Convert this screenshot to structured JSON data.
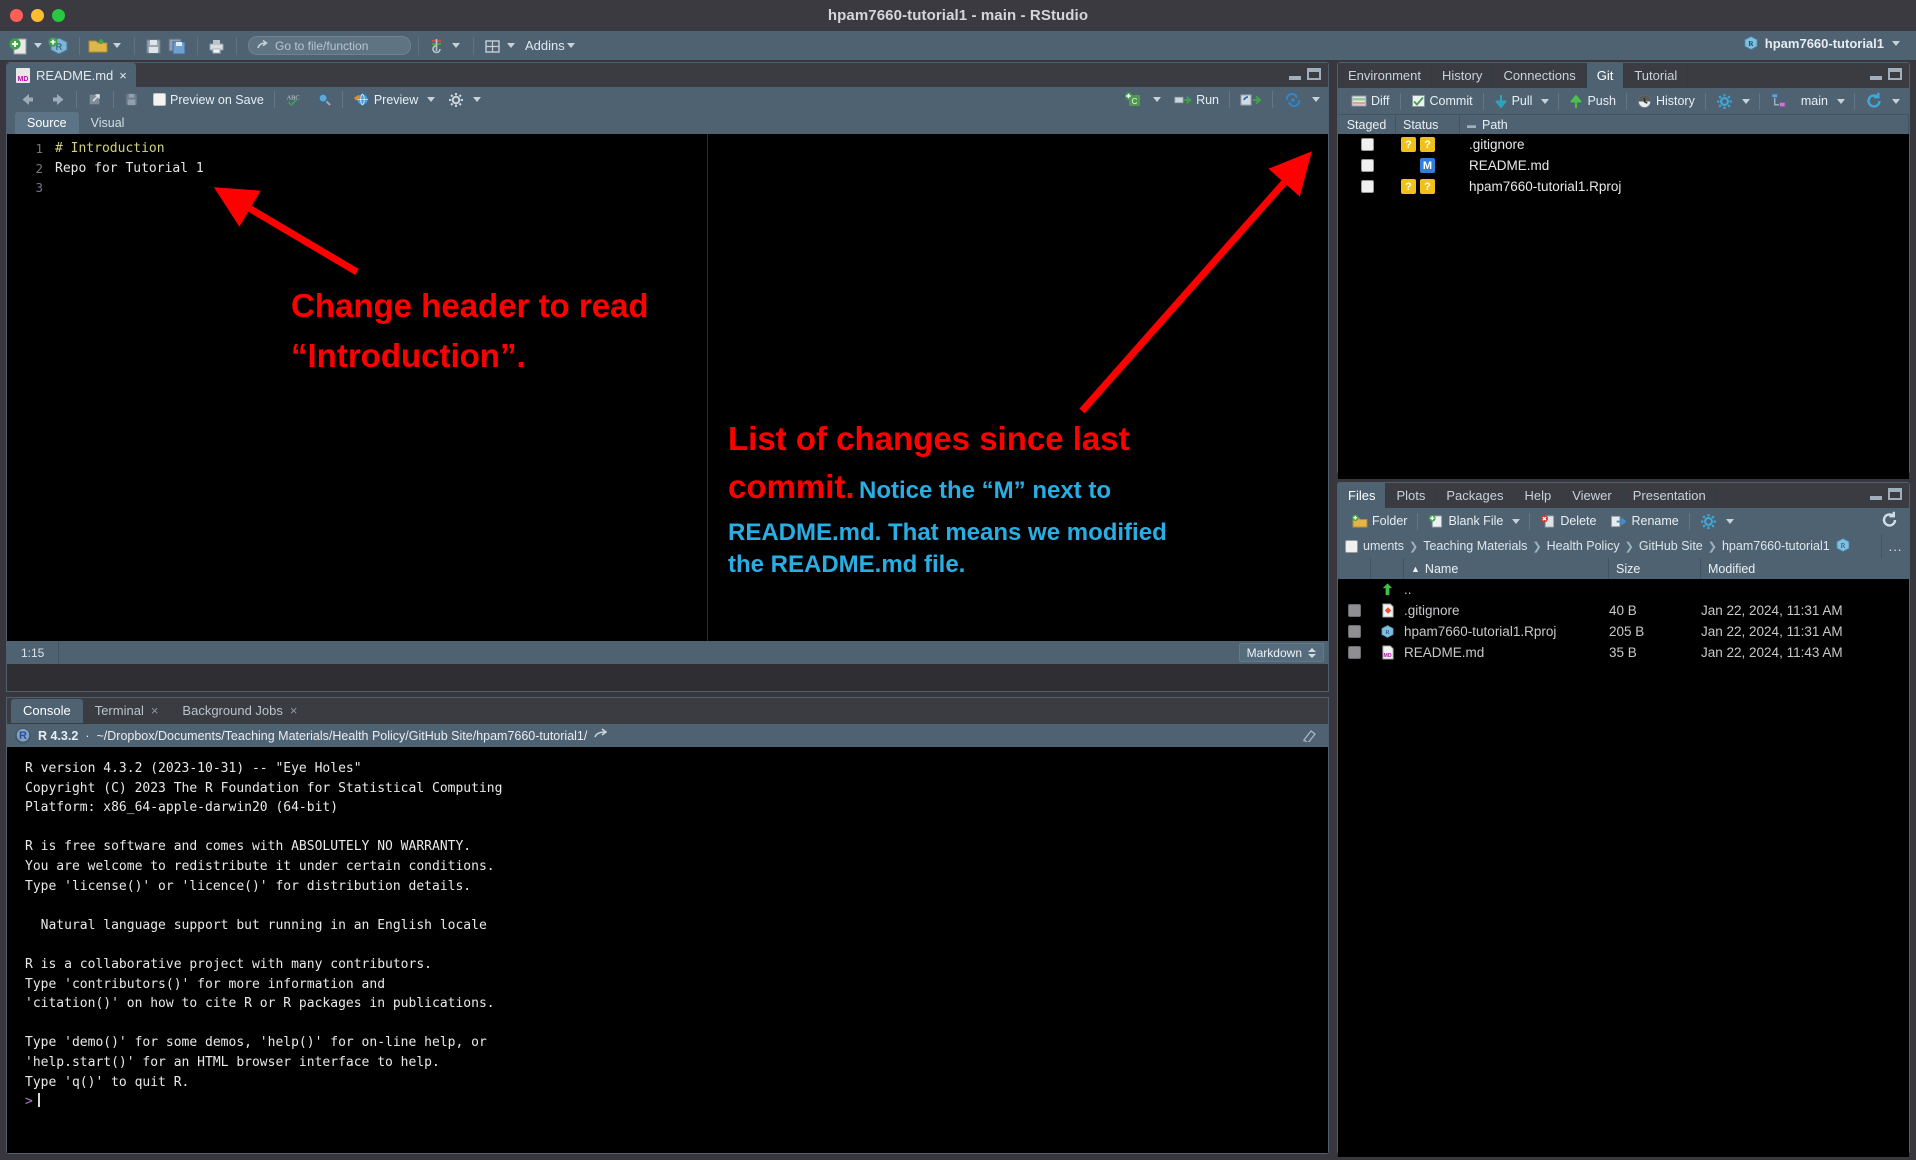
{
  "window": {
    "title": "hpam7660-tutorial1 - main - RStudio",
    "traffic_lights": [
      "close",
      "minimize",
      "zoom"
    ]
  },
  "main_toolbar": {
    "icons": [
      "new-file-icon",
      "new-project-icon",
      "open-file-icon",
      "save-icon",
      "save-all-icon",
      "print-icon"
    ],
    "goto_placeholder": "Go to file/function",
    "workspace_panes_label": "",
    "addins_label": "Addins",
    "project_label": "hpam7660-tutorial1"
  },
  "editor": {
    "file_tab": "README.md",
    "toolbar": {
      "preview_on_save": "Preview on Save",
      "preview": "Preview"
    },
    "modes": {
      "source": "Source",
      "visual": "Visual"
    },
    "run_label": "Run",
    "lines": [
      {
        "num": "1",
        "text": "# Introduction",
        "kind": "header"
      },
      {
        "num": "2",
        "text": "Repo for Tutorial 1",
        "kind": "plain"
      },
      {
        "num": "3",
        "text": "",
        "kind": "plain"
      }
    ],
    "status": {
      "position": "1:15",
      "format": "Markdown"
    }
  },
  "console": {
    "tabs": [
      {
        "label": "Console",
        "closable": false,
        "active": true
      },
      {
        "label": "Terminal",
        "closable": true,
        "active": false
      },
      {
        "label": "Background Jobs",
        "closable": true,
        "active": false
      }
    ],
    "r_version": "R 4.3.2",
    "separator": "·",
    "working_dir": "~/Dropbox/Documents/Teaching Materials/Health Policy/GitHub Site/hpam7660-tutorial1/",
    "output": "R version 4.3.2 (2023-10-31) -- \"Eye Holes\"\nCopyright (C) 2023 The R Foundation for Statistical Computing\nPlatform: x86_64-apple-darwin20 (64-bit)\n\nR is free software and comes with ABSOLUTELY NO WARRANTY.\nYou are welcome to redistribute it under certain conditions.\nType 'license()' or 'licence()' for distribution details.\n\n  Natural language support but running in an English locale\n\nR is a collaborative project with many contributors.\nType 'contributors()' for more information and\n'citation()' on how to cite R or R packages in publications.\n\nType 'demo()' for some demos, 'help()' for on-line help, or\n'help.start()' for an HTML browser interface to help.\nType 'q()' to quit R.\n",
    "prompt": ">"
  },
  "git_panel": {
    "tabs": [
      {
        "label": "Environment",
        "active": false
      },
      {
        "label": "History",
        "active": false
      },
      {
        "label": "Connections",
        "active": false
      },
      {
        "label": "Git",
        "active": true
      },
      {
        "label": "Tutorial",
        "active": false
      }
    ],
    "toolbar": {
      "diff": "Diff",
      "commit": "Commit",
      "pull": "Pull",
      "push": "Push",
      "history": "History",
      "gear": "gear-icon",
      "branch_icon": "branch-icon",
      "branch": "main",
      "refresh": "refresh-icon"
    },
    "columns": [
      "Staged",
      "Status",
      "Path"
    ],
    "rows": [
      {
        "staged": false,
        "status_left": "?",
        "status_right": "?",
        "status_kind": "untracked",
        "path": ".gitignore"
      },
      {
        "staged": false,
        "status_left": "",
        "status_right": "M",
        "status_kind": "modified",
        "path": "README.md"
      },
      {
        "staged": false,
        "status_left": "?",
        "status_right": "?",
        "status_kind": "untracked",
        "path": "hpam7660-tutorial1.Rproj"
      }
    ]
  },
  "files_panel": {
    "tabs": [
      {
        "label": "Files",
        "active": true
      },
      {
        "label": "Plots",
        "active": false
      },
      {
        "label": "Packages",
        "active": false
      },
      {
        "label": "Help",
        "active": false
      },
      {
        "label": "Viewer",
        "active": false
      },
      {
        "label": "Presentation",
        "active": false
      }
    ],
    "toolbar": {
      "new_folder": "Folder",
      "blank_file": "Blank File",
      "delete": "Delete",
      "rename": "Rename",
      "more": "gear-icon",
      "refresh": "refresh-icon"
    },
    "breadcrumb": [
      "uments",
      "Teaching Materials",
      "Health Policy",
      "GitHub Site",
      "hpam7660-tutorial1"
    ],
    "breadcrumb_more": "...",
    "columns": [
      "Name",
      "Size",
      "Modified"
    ],
    "sort_indicator": "▲",
    "rows": [
      {
        "icon": "up-folder-icon",
        "name": "..",
        "size": "",
        "modified": "",
        "checkbox": false
      },
      {
        "icon": "gitignore-icon",
        "name": ".gitignore",
        "size": "40 B",
        "modified": "Jan 22, 2024, 11:31 AM",
        "checkbox": true
      },
      {
        "icon": "rproj-icon",
        "name": "hpam7660-tutorial1.Rproj",
        "size": "205 B",
        "modified": "Jan 22, 2024, 11:31 AM",
        "checkbox": true
      },
      {
        "icon": "markdown-icon",
        "name": "README.md",
        "size": "35 B",
        "modified": "Jan 22, 2024, 11:43 AM",
        "checkbox": true
      }
    ]
  },
  "annotations": {
    "accent_red": "#fe0000",
    "accent_blue": "#29aee4",
    "callout_1": "Change header to read\n“Introduction”.",
    "callout_1_line1": "Change header to read",
    "callout_1_line2": "“Introduction”.",
    "callout_2_red": "List of changes since last",
    "callout_2_red_2": "commit.",
    "callout_2_blue_1": "Notice the “M” next to",
    "callout_2_blue_2": "README.md. That means we modified",
    "callout_2_blue_3": "the README.md file."
  }
}
